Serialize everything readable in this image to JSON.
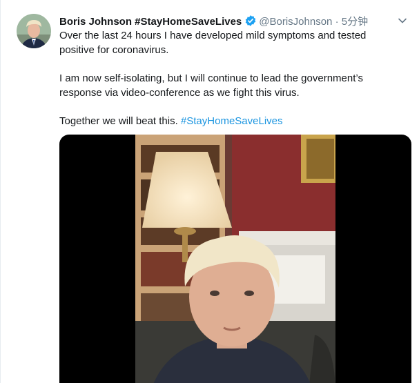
{
  "tweet": {
    "display_name": "Boris Johnson #StayHomeSaveLives",
    "handle": "@BorisJohnson",
    "separator": "·",
    "time": "5分钟",
    "paragraphs": [
      "Over the last 24 hours I have developed mild symptoms and tested positive for coronavirus.",
      "I am now self-isolating, but I will continue to lead the government’s response via video-conference as we fight this virus."
    ],
    "closing_text": "Together we will beat this. ",
    "hashtag": "#StayHomeSaveLives"
  },
  "icons": {
    "verified": "verified-badge-icon",
    "caret": "chevron-down-icon"
  },
  "colors": {
    "link": "#1b95e0",
    "verified": "#1da1f2",
    "secondary_text": "#657786",
    "media_background": "#000000"
  }
}
